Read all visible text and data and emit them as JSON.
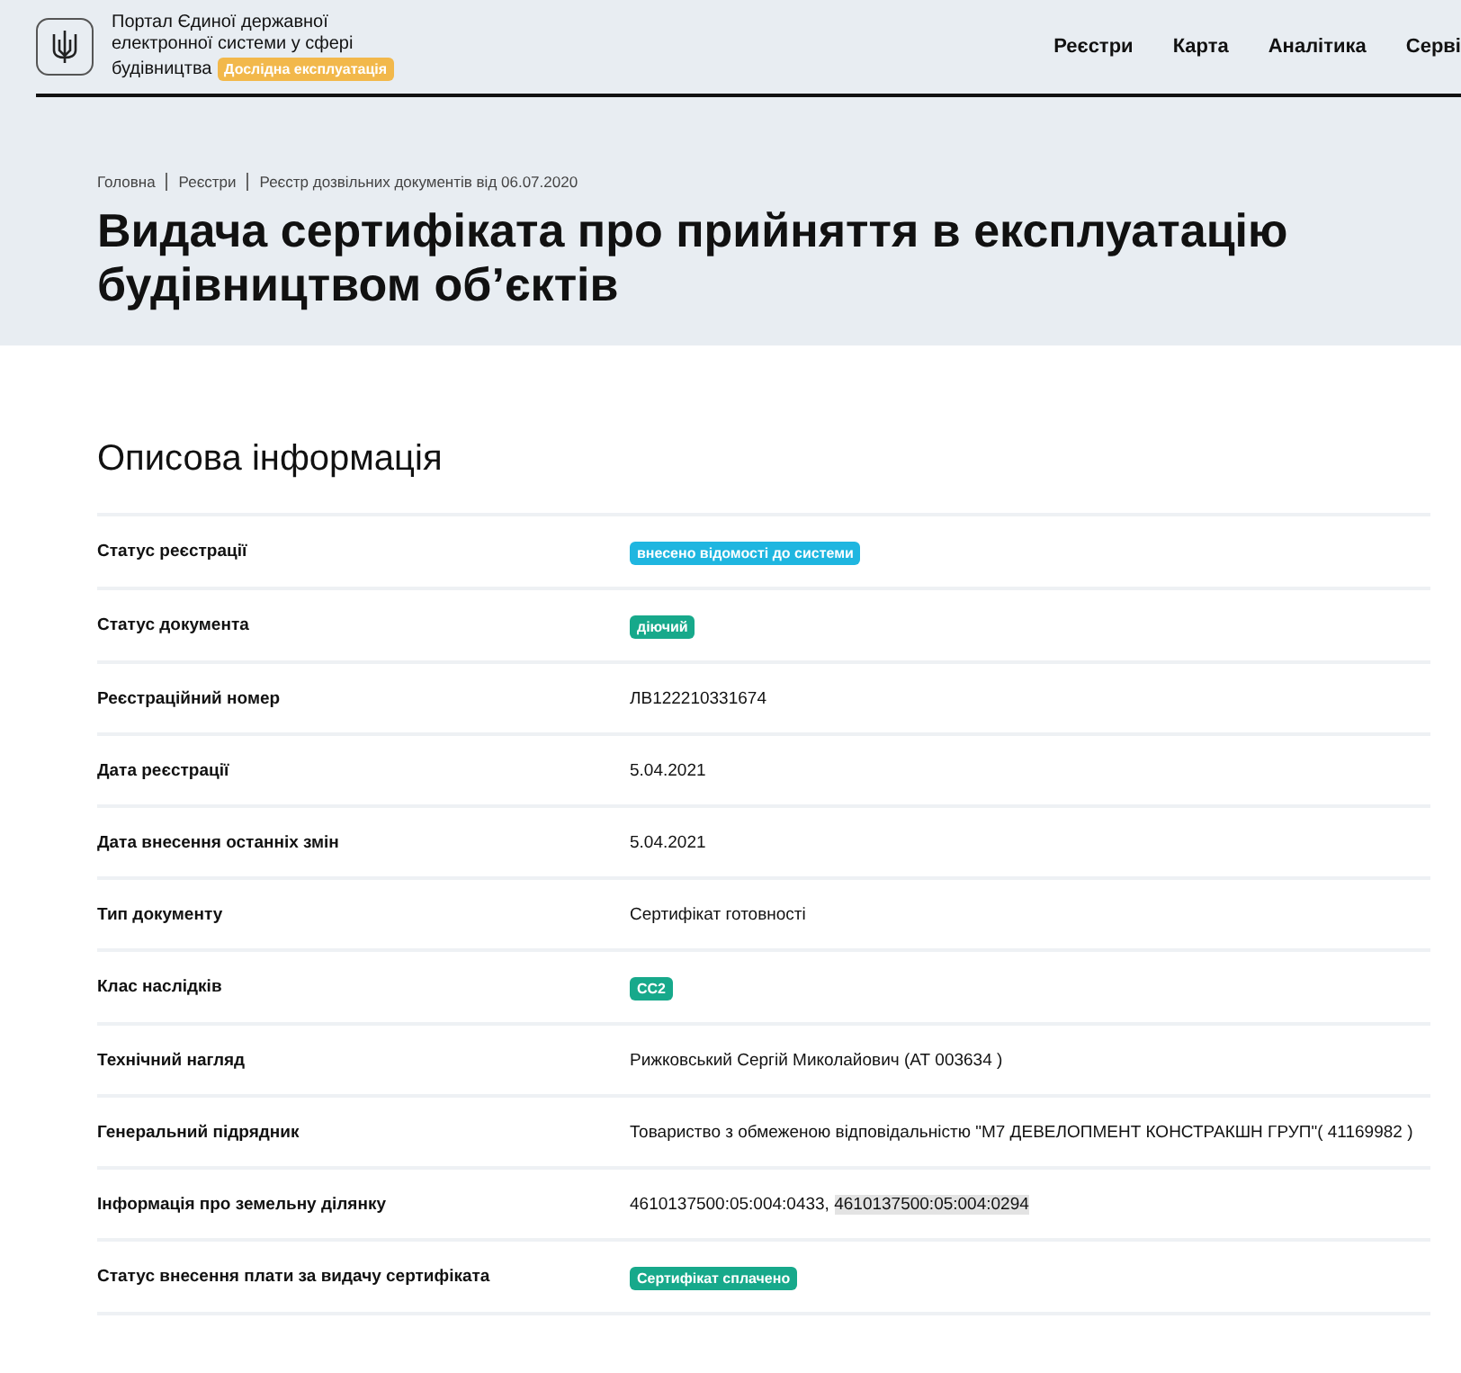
{
  "header": {
    "portal_name": "Портал Єдиної державної електронної системи у сфері будівництва",
    "badge": "Дослідна експлуатація",
    "nav": [
      "Реєстри",
      "Карта",
      "Аналітика",
      "Серві"
    ]
  },
  "breadcrumbs": [
    "Головна",
    "Реєстри",
    "Реєстр дозвільних документів від 06.07.2020"
  ],
  "title": "Видача сертифіката про прийняття в експлуатацію будівництвом об’єктів",
  "section_title": "Описова інформація",
  "rows": [
    {
      "label": "Статус реєстрації",
      "kind": "badge",
      "value": "внесено відомості до системи",
      "color": "#1fb6e0"
    },
    {
      "label": "Статус документа",
      "kind": "badge",
      "value": "діючий",
      "color": "#17a98b"
    },
    {
      "label": "Реєстраційний номер",
      "kind": "text",
      "value": "ЛВ122210331674"
    },
    {
      "label": "Дата реєстрації",
      "kind": "text",
      "value": "5.04.2021"
    },
    {
      "label": "Дата внесення останніх змін",
      "kind": "text",
      "value": "5.04.2021"
    },
    {
      "label": "Тип документу",
      "kind": "text",
      "value": "Сертифікат готовності"
    },
    {
      "label": "Клас наслідків",
      "kind": "badge",
      "value": "СС2",
      "color": "#17a98b"
    },
    {
      "label": "Технічний нагляд",
      "kind": "text",
      "value": "Рижковський Сергій Миколайович (АТ 003634 )"
    },
    {
      "label": "Генеральний підрядник",
      "kind": "text",
      "value": "Товариство з обмеженою відповідальністю \"М7 ДЕВЕЛОПМЕНТ КОНСТРАКШН ГРУП\"( 41169982 )"
    },
    {
      "label": "Інформація про земельну ділянку",
      "kind": "parts",
      "parts": [
        {
          "text": "4610137500:05:004:0433, ",
          "highlighted": false
        },
        {
          "text": "4610137500:05:004:0294",
          "highlighted": true
        }
      ]
    },
    {
      "label": "Статус внесення плати за видачу сертифіката",
      "kind": "badge",
      "value": "Сертифікат сплачено",
      "color": "#17a98b"
    }
  ]
}
